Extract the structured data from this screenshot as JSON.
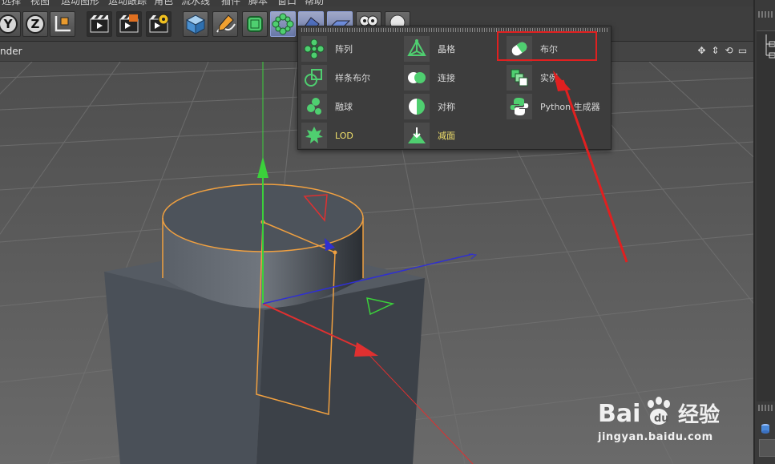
{
  "menubar": {
    "items": [
      "选择",
      "视图",
      "运动图形",
      "运动跟踪",
      "角色",
      "流水线",
      "插件",
      "脚本",
      "窗口",
      "帮助"
    ]
  },
  "toolbar": {
    "axis_buttons": [
      "Y",
      "Z"
    ],
    "buttons": [
      "world-coordinates",
      "render-view",
      "render-picture-viewer",
      "render-settings",
      "cube",
      "pen",
      "subdivision",
      "array-generator",
      "deformer",
      "floor",
      "camera",
      "light"
    ]
  },
  "viewport": {
    "name": "nder",
    "header_icons": [
      "move-icon",
      "arrows-icon",
      "rotate-icon",
      "layout-icon"
    ]
  },
  "popup": {
    "columns": [
      [
        {
          "label": "阵列",
          "icon": "array-icon"
        },
        {
          "label": "样条布尔",
          "icon": "spline-boolean-icon"
        },
        {
          "label": "融球",
          "icon": "metaball-icon"
        },
        {
          "label": "LOD",
          "icon": "lod-icon",
          "highlight": true
        }
      ],
      [
        {
          "label": "晶格",
          "icon": "atom-icon"
        },
        {
          "label": "连接",
          "icon": "connect-icon"
        },
        {
          "label": "对称",
          "icon": "symmetry-icon"
        },
        {
          "label": "减面",
          "icon": "polygon-reduction-icon",
          "highlight": true
        }
      ],
      [
        {
          "label": "布尔",
          "icon": "boolean-icon"
        },
        {
          "label": "实例",
          "icon": "instance-icon"
        },
        {
          "label": "Python 生成器",
          "icon": "python-icon"
        }
      ]
    ]
  },
  "colors": {
    "accent_highlight": "#f1e06b",
    "annotation_red": "#e02020",
    "selection_orange": "#f0a040"
  },
  "watermark": {
    "brand": "Bai du 经验",
    "url": "jingyan.baidu.com"
  }
}
